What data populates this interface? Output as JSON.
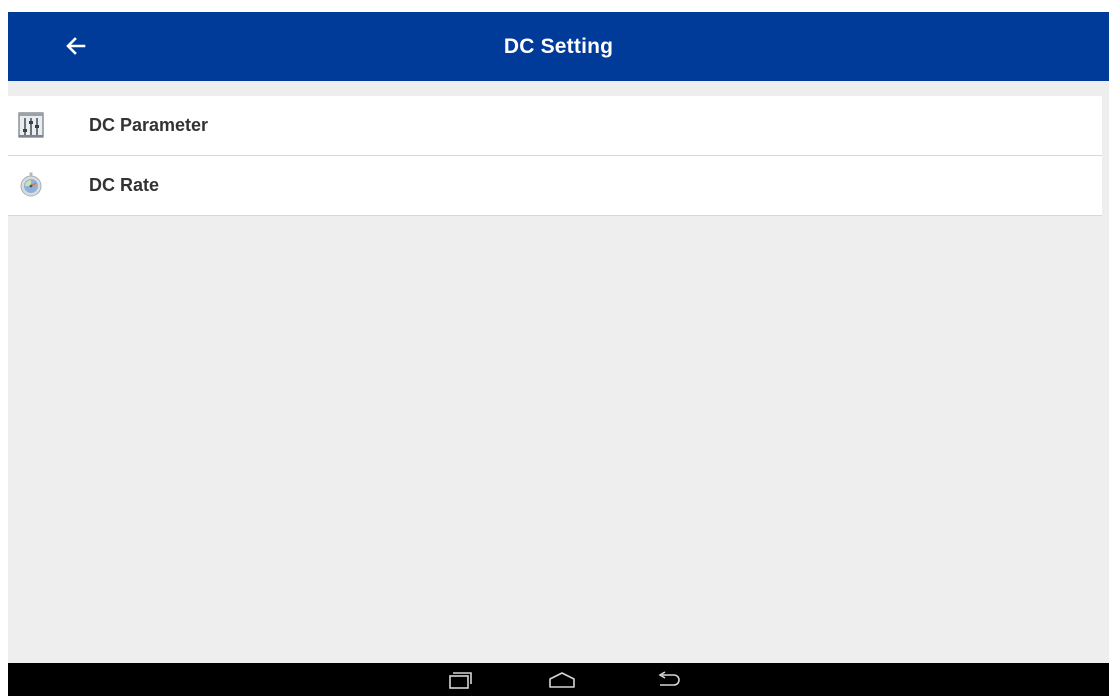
{
  "header": {
    "title": "DC Setting",
    "back_icon": "arrow-left-icon",
    "background_color": "#003b9a"
  },
  "settings": {
    "items": [
      {
        "label": "DC Parameter",
        "icon": "sliders-icon"
      },
      {
        "label": "DC Rate",
        "icon": "gauge-icon"
      }
    ]
  },
  "nav_bar": {
    "buttons": [
      "recent-apps-icon",
      "home-icon",
      "back-icon"
    ]
  }
}
